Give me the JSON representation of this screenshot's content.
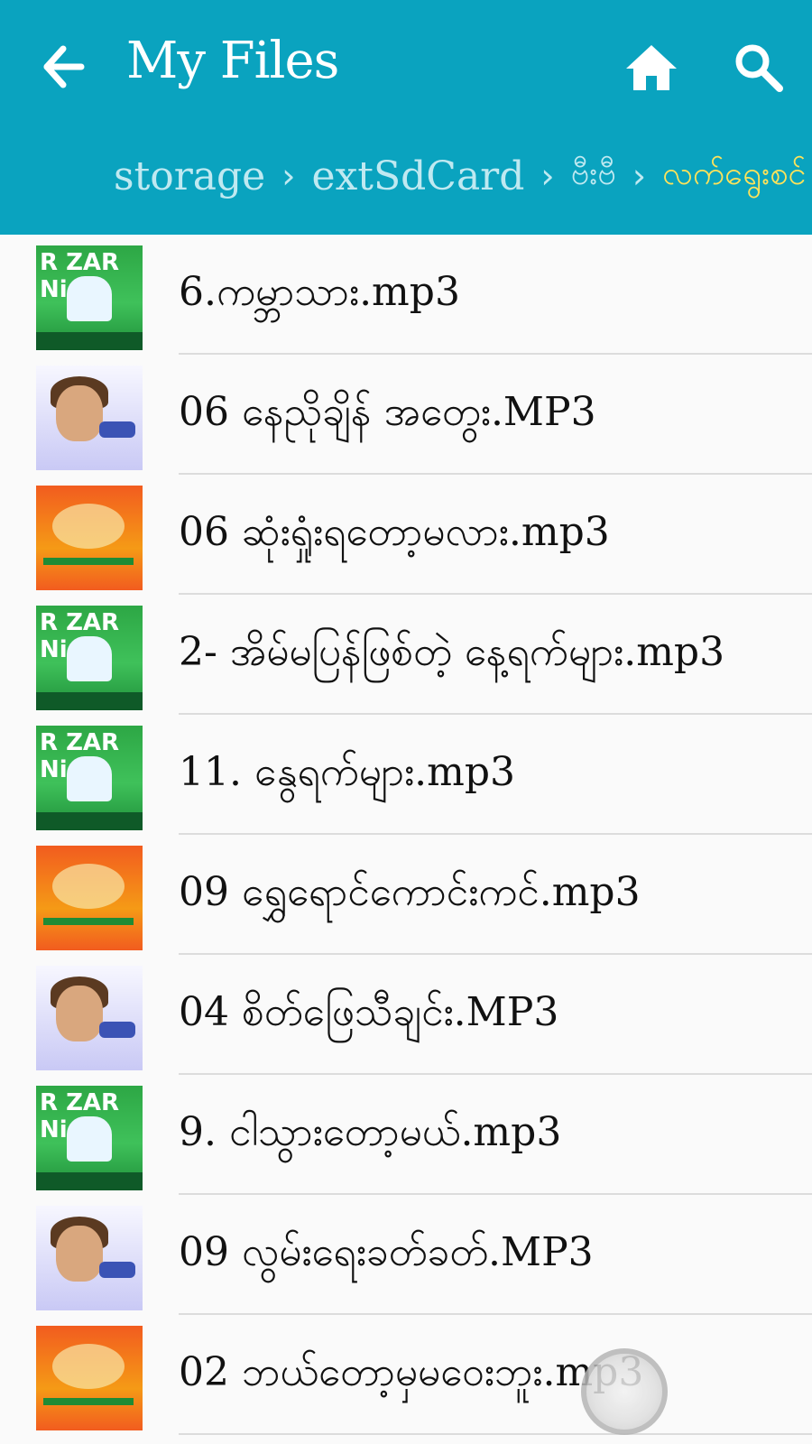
{
  "header": {
    "title": "My Files",
    "back_icon": "arrow-left-icon",
    "home_icon": "home-icon",
    "search_icon": "search-icon",
    "background_color": "#0aa3bf"
  },
  "breadcrumbs": [
    "storage",
    "extSdCard",
    "ဗီးဗီ",
    "လက်ရွေးစင်"
  ],
  "files": [
    {
      "name": "6.ကမ္ဘာသား.mp3",
      "thumb": "green"
    },
    {
      "name": "06 နေညိုချိန် အတွေး.MP3",
      "thumb": "blue"
    },
    {
      "name": "06 ဆုံးရှုံးရတော့မလား.mp3",
      "thumb": "red"
    },
    {
      "name": "2- အိမ်မပြန်ဖြစ်တဲ့ နေ့ရက်များ.mp3",
      "thumb": "green"
    },
    {
      "name": "11. နွေရက်များ.mp3",
      "thumb": "green"
    },
    {
      "name": "09 ရွှေရောင်ကောင်းကင်.mp3",
      "thumb": "red"
    },
    {
      "name": "04 စိတ်ဖြေသီချင်း.MP3",
      "thumb": "blue"
    },
    {
      "name": "9. ငါသွားတော့မယ်.mp3",
      "thumb": "green"
    },
    {
      "name": "09 လွမ်းရေးခတ်ခတ်.MP3",
      "thumb": "blue"
    },
    {
      "name": "02 ဘယ်တော့မှမဝေးဘူး.mp3",
      "thumb": "red"
    }
  ],
  "thumb_text": {
    "green": "R ZAR Ni"
  }
}
